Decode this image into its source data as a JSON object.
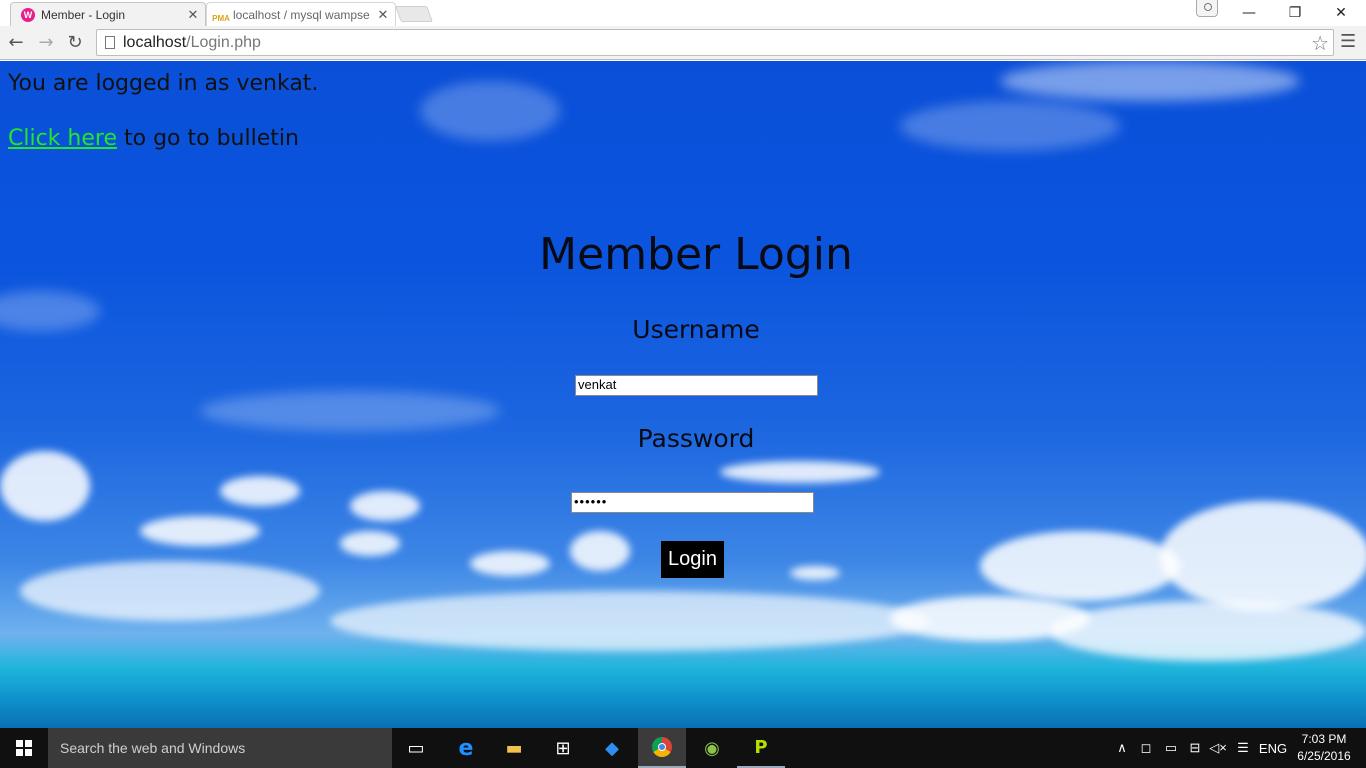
{
  "browser": {
    "tabs": [
      {
        "title": "Member - Login",
        "favicon": "W",
        "active": true
      },
      {
        "title": "localhost / mysql wampse",
        "favicon": "PMA",
        "active": false
      }
    ],
    "url_host": "localhost",
    "url_path": "/Login.php"
  },
  "page": {
    "status_text": "You are logged in as venkat.",
    "link_text": "Click here",
    "link_suffix": " to go to bulletin",
    "title": "Member Login",
    "username_label": "Username",
    "username_value": "venkat",
    "password_label": "Password",
    "password_value": "••••••",
    "login_button": "Login"
  },
  "taskbar": {
    "search_placeholder": "Search the web and Windows",
    "language": "ENG",
    "time": "7:03 PM",
    "date": "6/25/2016"
  }
}
